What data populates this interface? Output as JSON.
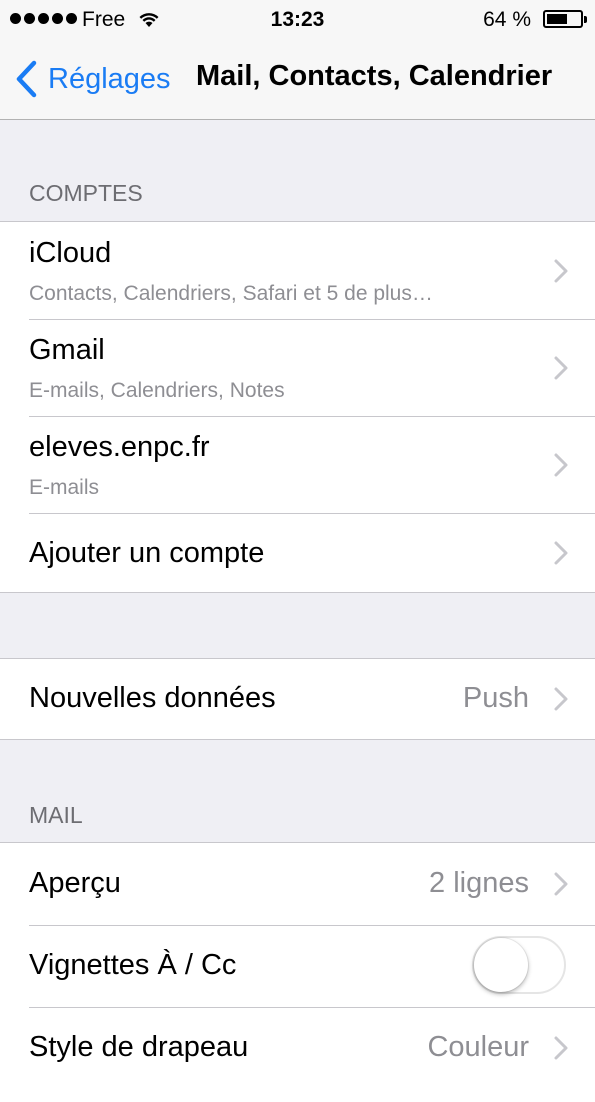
{
  "status_bar": {
    "carrier": "Free",
    "time": "13:23",
    "battery_percent": "64 %",
    "battery_level": 0.64
  },
  "nav": {
    "back_label": "Réglages",
    "title": "Mail, Contacts, Calendrier"
  },
  "accounts": {
    "header": "COMPTES",
    "items": [
      {
        "title": "iCloud",
        "subtitle": "Contacts, Calendriers, Safari et 5 de plus…"
      },
      {
        "title": "Gmail",
        "subtitle": "E-mails, Calendriers, Notes"
      },
      {
        "title": "eleves.enpc.fr",
        "subtitle": "E-mails"
      }
    ],
    "add_account": "Ajouter un compte"
  },
  "fetch": {
    "label": "Nouvelles données",
    "value": "Push"
  },
  "mail": {
    "header": "MAIL",
    "preview_label": "Aperçu",
    "preview_value": "2 lignes",
    "to_cc_label": "Vignettes À / Cc",
    "to_cc_on": false,
    "flag_style_label": "Style de drapeau",
    "flag_style_value": "Couleur"
  },
  "colors": {
    "accent": "#1a7cf4",
    "background": "#efeff4",
    "secondary_text": "#8e8e93",
    "section_header": "#6d6d72"
  }
}
